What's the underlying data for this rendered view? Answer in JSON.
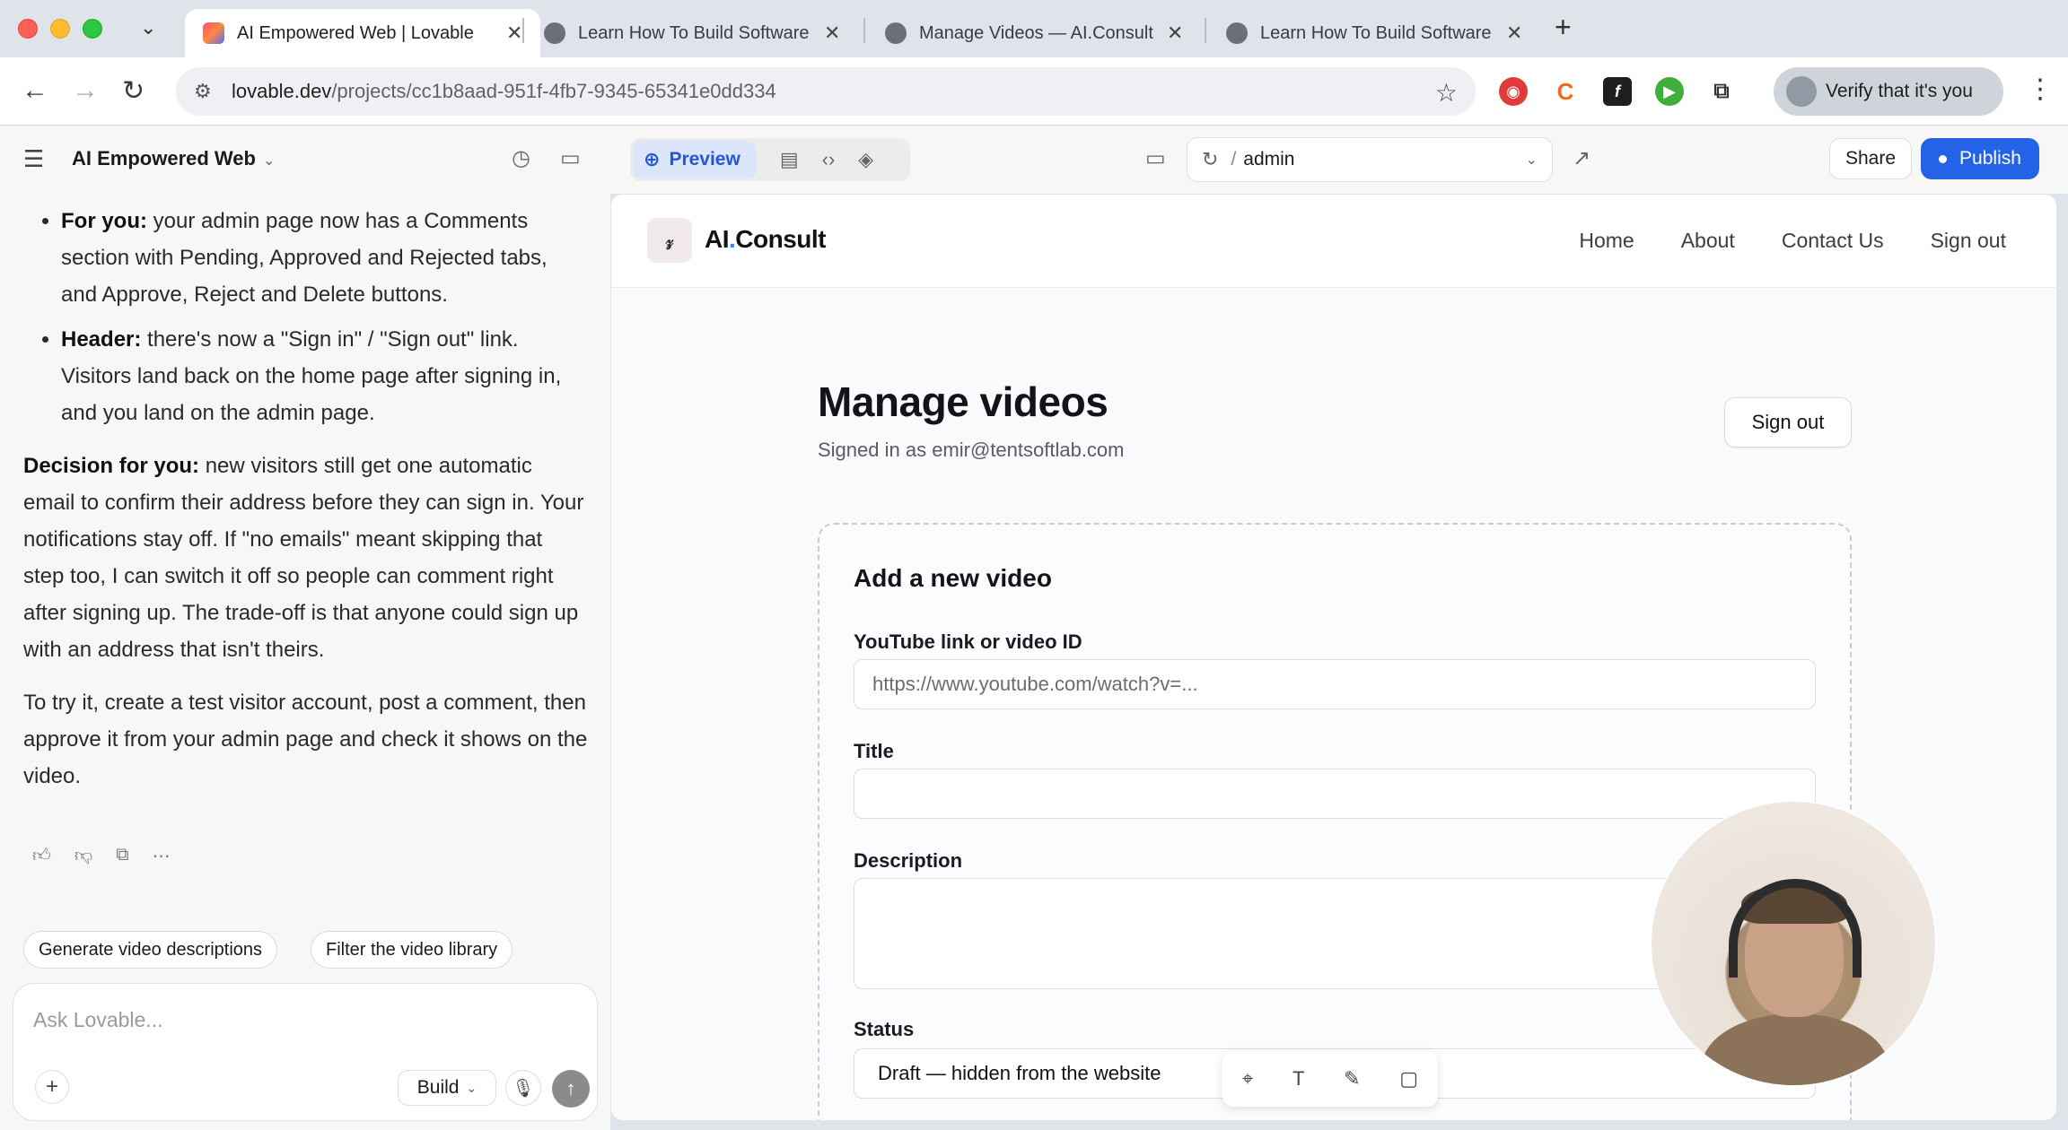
{
  "browser": {
    "tabs": [
      {
        "title": "AI Empowered Web | Lovable",
        "active": true,
        "favicon_color": "#e8532f"
      },
      {
        "title": "Learn How To Build Software",
        "active": false,
        "favicon_color": "#6b6f76"
      },
      {
        "title": "Manage Videos — AI.Consult",
        "active": false,
        "favicon_color": "#6b6f76"
      },
      {
        "title": "Learn How To Build Software",
        "active": false,
        "favicon_color": "#6b6f76"
      }
    ],
    "url_host": "lovable.dev",
    "url_path": "/projects/cc1b8aad-951f-4fb7-9345-65341e0dd334",
    "profile_label": "Verify that it's you"
  },
  "appbar": {
    "project_name": "AI Empowered Web",
    "preview_label": "Preview",
    "route": "admin",
    "share_label": "Share",
    "publish_label": "Publish"
  },
  "chat": {
    "bullets": [
      {
        "lead": "For you:",
        "text": " your admin page now has a Comments section with Pending, Approved and Rejected tabs, and Approve, Reject and Delete buttons."
      },
      {
        "lead": "Header:",
        "text": " there's now a \"Sign in\" / \"Sign out\" link. Visitors land back on the home page after signing in, and you land on the admin page."
      }
    ],
    "decision_lead": "Decision for you:",
    "decision_text": " new visitors still get one automatic email to confirm their address before they can sign in. Your notifications stay off. If \"no emails\" meant skipping that step too, I can switch it off so people can comment right after signing up. The trade-off is that anyone could sign up with an address that isn't theirs.",
    "try_text": "To try it, create a test visitor account, post a comment, then approve it from your admin page and check it shows on the video.",
    "suggestions": [
      "Generate video descriptions",
      "Filter the video library"
    ],
    "composer_placeholder": "Ask Lovable...",
    "mode_label": "Build"
  },
  "site": {
    "brand_prefix": "AI",
    "brand_dot": ".",
    "brand_suffix": "Consult",
    "nav": [
      "Home",
      "About",
      "Contact Us",
      "Sign out"
    ],
    "heading": "Manage videos",
    "signed_in": "Signed in as emir@tentsoftlab.com",
    "signout_label": "Sign out",
    "form": {
      "title": "Add a new video",
      "youtube_label": "YouTube link or video ID",
      "youtube_placeholder": "https://www.youtube.com/watch?v=...",
      "title_label": "Title",
      "title_value": "",
      "description_label": "Description",
      "description_value": "",
      "status_label": "Status",
      "status_value": "Draft — hidden from the website"
    }
  },
  "colors": {
    "accent": "#2462e8",
    "brand_dot": "#3b82f6"
  }
}
